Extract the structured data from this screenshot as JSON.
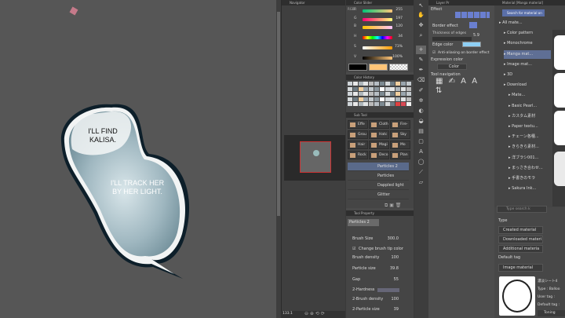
{
  "canvas": {
    "balloon_text_1": "I'LL FIND KALISA.",
    "balloon_text_2": "I'LL TRACK HER BY HER LIGHT."
  },
  "navigator": {
    "title": "Navigator",
    "zoom": "133.1"
  },
  "color_slider": {
    "title": "Color Slider",
    "mode": "RGB",
    "r": {
      "label": "R",
      "value": "255"
    },
    "g": {
      "label": "G",
      "value": "197"
    },
    "b": {
      "label": "B",
      "value": "120"
    },
    "h": {
      "label": "H",
      "value": "34"
    },
    "s": {
      "label": "S",
      "value": "73%"
    },
    "v": {
      "label": "V",
      "value": "100%"
    },
    "main_color": "#000000",
    "sub_color": "#ffc578"
  },
  "color_history": {
    "title": "Color History"
  },
  "sub_tool": {
    "title": "Sub Tool",
    "tabs": [
      "Effe",
      "Cloth",
      "Fire-",
      "Grou",
      "Hatc",
      "Sky",
      "Hair",
      "Magi",
      "Mo",
      "Rock",
      "Deco",
      "Plan"
    ],
    "items": [
      "Particles 2",
      "Particles",
      "Dappled light",
      "Glitter"
    ]
  },
  "tool_property": {
    "title": "Tool Property",
    "tool_name": "Particles 2",
    "brush_size": {
      "label": "Brush Size",
      "value": "300.0"
    },
    "change_tip": "Change brush tip color",
    "brush_density": {
      "label": "Brush density",
      "value": "100"
    },
    "particle_size": {
      "label": "Particle size",
      "value": "39.8"
    },
    "gap": {
      "label": "Gap",
      "value": "55"
    },
    "hardness": {
      "label": "2-Hardness"
    },
    "brush_density_2": {
      "label": "2-Brush density",
      "value": "100"
    },
    "particle_size_2": {
      "label": "2-Particle size",
      "value": "39"
    }
  },
  "layer_panel": {
    "title": "Layer Pr"
  },
  "effect": {
    "title": "Effect",
    "border_effect": "Border effect",
    "thickness_label": "Thickness of edges",
    "thickness_value": "5.9",
    "edge_color_label": "Edge color",
    "edge_color": "#8ecff5",
    "anti_alias": "Anti-aliasing on border effect",
    "expression_color_label": "Expression color",
    "expression_color_value": "Color",
    "tool_navigation": "Tool navigation"
  },
  "material": {
    "title": "Material [Manga material]",
    "search_placeholder": "Search for material on",
    "tree": [
      "All mate...",
      "Color pattern",
      "Monochrome",
      "Manga mat...",
      "Image mat...",
      "3D",
      "Download",
      "Mate...",
      "Basic Pearl...",
      "カスタム素材",
      "Paper textu...",
      "チェーン各種...",
      "きらきら素材...",
      "洋ブラシ001...",
      "まっさき合わせ...",
      "手書きのモラ",
      "Sakura Ink..."
    ],
    "search_tag_placeholder": "Type search k",
    "type_label": "Type",
    "categories": [
      "Created material",
      "Downloaded materi",
      "Additional materia"
    ],
    "default_tag_label": "Default tag",
    "default_tag_value": "Image material",
    "info_name": "濃淡シート4",
    "info_type": "Type : Balloo",
    "info_user_tag": "User tag :",
    "info_default_tag": "Default tag :",
    "info_toning": "Toning"
  }
}
